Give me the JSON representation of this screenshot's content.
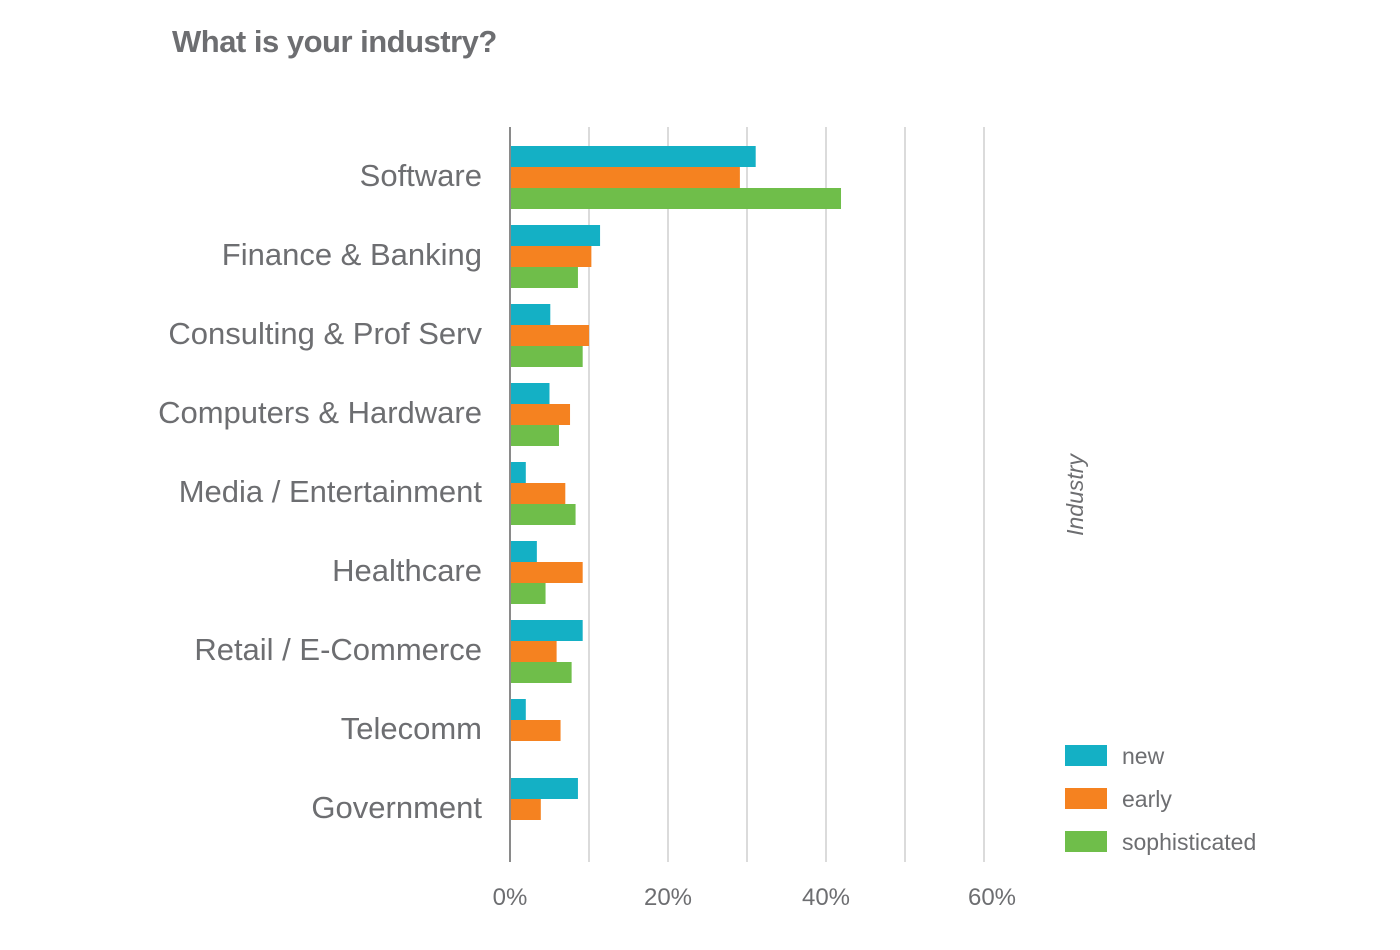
{
  "chart_data": {
    "type": "bar",
    "orientation": "horizontal",
    "title": "What is your industry?",
    "xlabel": "",
    "ylabel": "Industry",
    "xlim": [
      0,
      60
    ],
    "gridline_step": 10,
    "x_ticks": [
      "0%",
      "20%",
      "40%",
      "60%"
    ],
    "x_tick_values": [
      0,
      20,
      40,
      60
    ],
    "grid": true,
    "legend_position": "bottom-right",
    "categories": [
      "Software",
      "Finance & Banking",
      "Consulting & Prof Serv",
      "Computers & Hardware",
      "Media / Entertainment",
      "Healthcare",
      "Retail / E-Commerce",
      "Telecomm",
      "Government"
    ],
    "series": [
      {
        "name": "new",
        "color": "#14b0c5",
        "values": [
          31.1,
          11.4,
          5.1,
          5.0,
          2.0,
          3.4,
          9.2,
          2.0,
          8.6
        ]
      },
      {
        "name": "early",
        "color": "#f58220",
        "values": [
          29.1,
          10.3,
          10.0,
          7.6,
          7.0,
          9.2,
          5.9,
          6.4,
          3.9
        ]
      },
      {
        "name": "sophisticated",
        "color": "#6fbe4a",
        "values": [
          41.9,
          8.6,
          9.2,
          6.2,
          8.3,
          4.5,
          7.8,
          null,
          null
        ]
      }
    ]
  }
}
